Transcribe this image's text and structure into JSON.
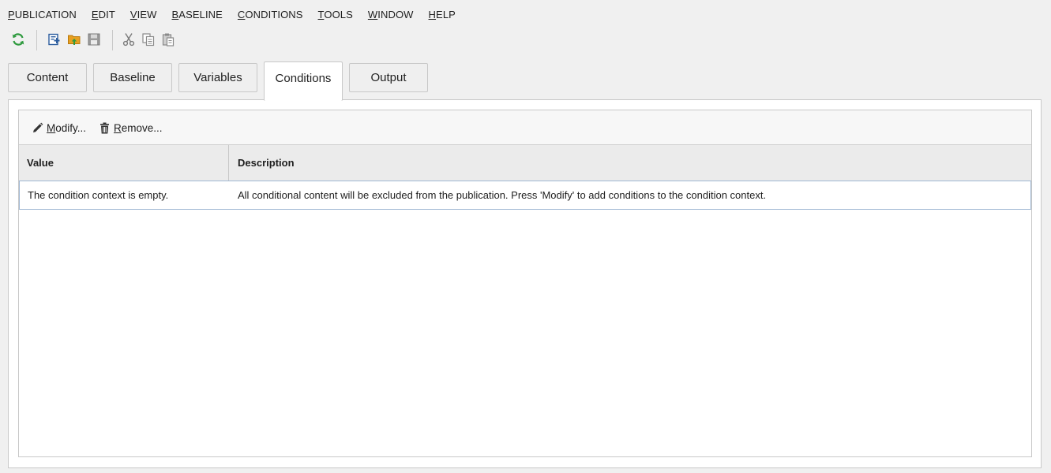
{
  "menu": [
    {
      "mnemonic": "P",
      "rest": "UBLICATION"
    },
    {
      "mnemonic": "E",
      "rest": "DIT"
    },
    {
      "mnemonic": "V",
      "rest": "IEW"
    },
    {
      "mnemonic": "B",
      "rest": "ASELINE"
    },
    {
      "mnemonic": "C",
      "rest": "ONDITIONS"
    },
    {
      "mnemonic": "T",
      "rest": "OOLS"
    },
    {
      "mnemonic": "W",
      "rest": "INDOW"
    },
    {
      "mnemonic": "H",
      "rest": "ELP"
    }
  ],
  "toolbar": {
    "icons": [
      "refresh-icon",
      "new-publication-icon",
      "open-folder-icon",
      "save-icon",
      "cut-icon",
      "copy-icon",
      "paste-icon"
    ]
  },
  "tabs": [
    {
      "label": "Content"
    },
    {
      "label": "Baseline"
    },
    {
      "label": "Variables"
    },
    {
      "label": "Conditions"
    },
    {
      "label": "Output"
    }
  ],
  "active_tab": "Conditions",
  "conditions_panel": {
    "modify": {
      "mnemonic": "M",
      "rest": "odify..."
    },
    "remove": {
      "mnemonic": "R",
      "rest": "emove..."
    },
    "columns": [
      "Value",
      "Description"
    ],
    "rows": [
      {
        "value": "The condition context is empty.",
        "description": "All conditional content will be excluded from the publication. Press 'Modify' to add conditions to the condition context."
      }
    ]
  },
  "colors": {
    "background": "#f0f0f0",
    "panel": "#ffffff",
    "border": "#c8c8c8",
    "header_bg": "#ebebeb",
    "row_border": "#9fb7d3",
    "refresh_green": "#2e9a3e",
    "folder_orange": "#e8a020"
  }
}
